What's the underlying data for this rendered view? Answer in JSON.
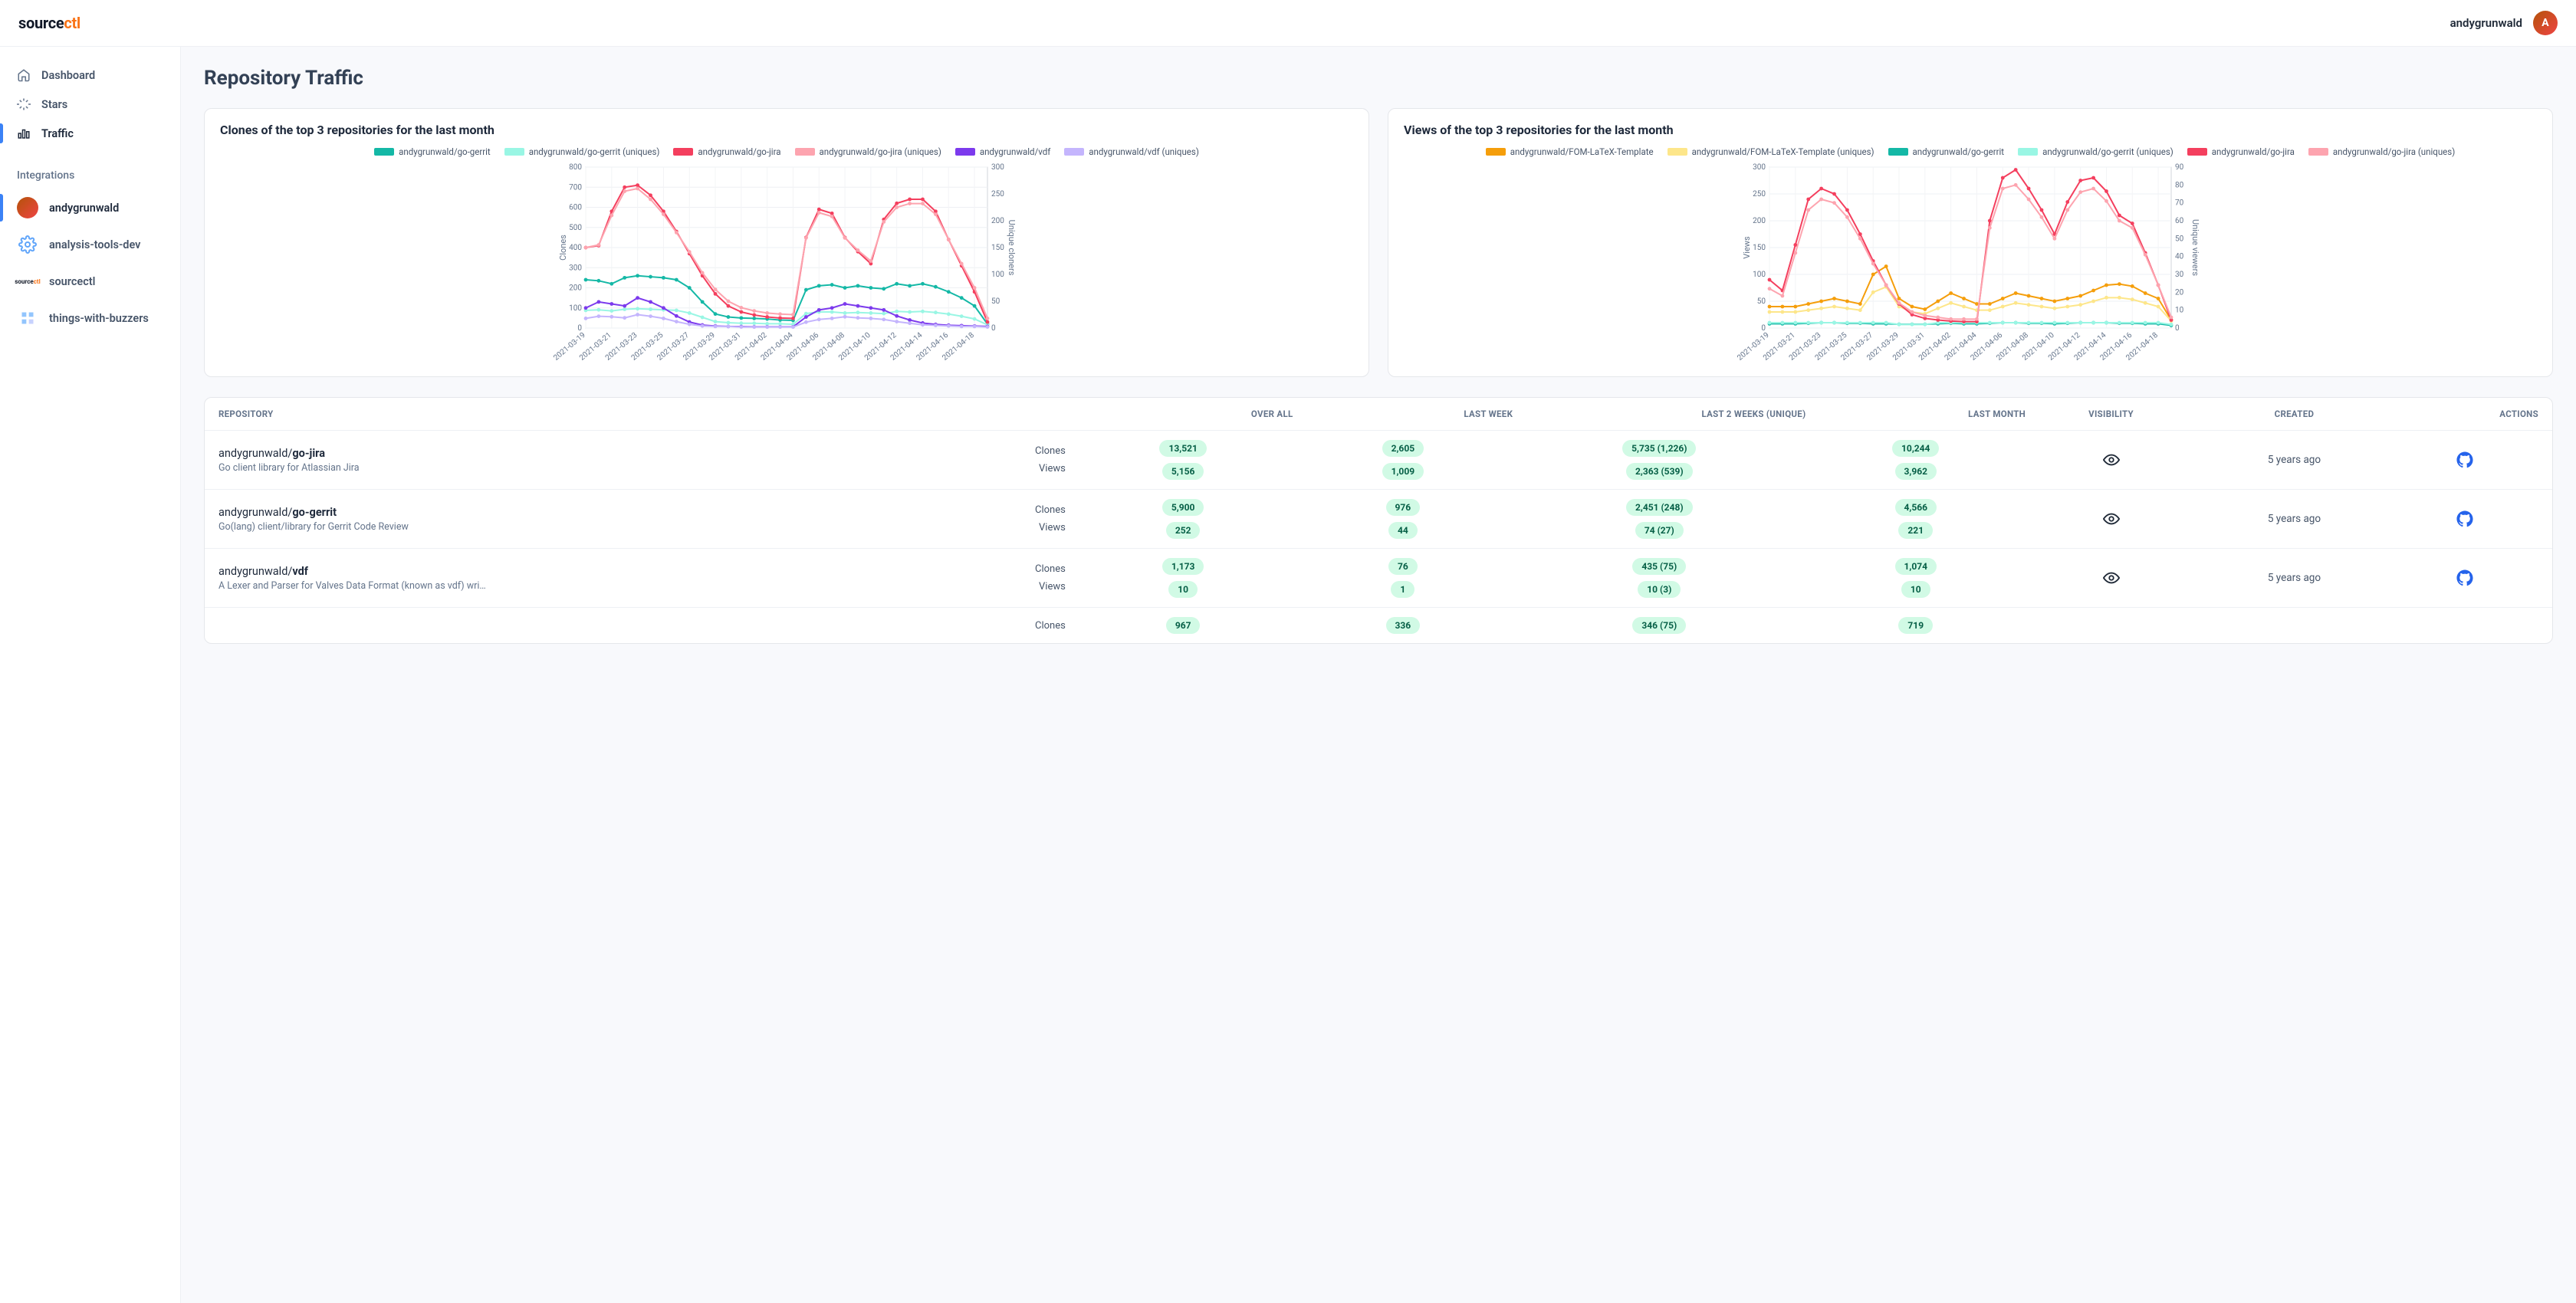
{
  "brand": {
    "part1": "source",
    "part2": "ctl"
  },
  "user": {
    "name": "andygrunwald"
  },
  "sidebar": {
    "nav": [
      {
        "label": "Dashboard",
        "icon": "home"
      },
      {
        "label": "Stars",
        "icon": "sparkle"
      },
      {
        "label": "Traffic",
        "icon": "bars",
        "active": true
      }
    ],
    "integrations_label": "Integrations",
    "integrations": [
      {
        "label": "andygrunwald",
        "icon": "avatar",
        "active": true
      },
      {
        "label": "analysis-tools-dev",
        "icon": "gear"
      },
      {
        "label": "sourcectl",
        "icon": "srcctl"
      },
      {
        "label": "things-with-buzzers",
        "icon": "buzz"
      }
    ]
  },
  "page": {
    "title": "Repository Traffic"
  },
  "charts": {
    "clones": {
      "title": "Clones of the top 3 repositories for the last month",
      "y_left_label": "Clones",
      "y_right_label": "Unique cloners",
      "legend": [
        {
          "label": "andygrunwald/go-gerrit",
          "color": "#14b8a6"
        },
        {
          "label": "andygrunwald/go-gerrit (uniques)",
          "color": "#99f6e4"
        },
        {
          "label": "andygrunwald/go-jira",
          "color": "#f43f5e"
        },
        {
          "label": "andygrunwald/go-jira (uniques)",
          "color": "#fda4af"
        },
        {
          "label": "andygrunwald/vdf",
          "color": "#7c3aed"
        },
        {
          "label": "andygrunwald/vdf (uniques)",
          "color": "#c4b5fd"
        }
      ]
    },
    "views": {
      "title": "Views of the top 3 repositories for the last month",
      "y_left_label": "Views",
      "y_right_label": "Unique viewers",
      "legend": [
        {
          "label": "andygrunwald/FOM-LaTeX-Template",
          "color": "#f59e0b"
        },
        {
          "label": "andygrunwald/FOM-LaTeX-Template (uniques)",
          "color": "#fde68a"
        },
        {
          "label": "andygrunwald/go-gerrit",
          "color": "#14b8a6"
        },
        {
          "label": "andygrunwald/go-gerrit (uniques)",
          "color": "#99f6e4"
        },
        {
          "label": "andygrunwald/go-jira",
          "color": "#f43f5e"
        },
        {
          "label": "andygrunwald/go-jira (uniques)",
          "color": "#fda4af"
        }
      ]
    }
  },
  "chart_data": [
    {
      "type": "line",
      "title": "Clones of the top 3 repositories for the last month",
      "x": [
        "2021-03-19",
        "2021-03-20",
        "2021-03-21",
        "2021-03-22",
        "2021-03-23",
        "2021-03-24",
        "2021-03-25",
        "2021-03-26",
        "2021-03-27",
        "2021-03-28",
        "2021-03-29",
        "2021-03-30",
        "2021-03-31",
        "2021-04-01",
        "2021-04-02",
        "2021-04-03",
        "2021-04-04",
        "2021-04-05",
        "2021-04-06",
        "2021-04-07",
        "2021-04-08",
        "2021-04-09",
        "2021-04-10",
        "2021-04-11",
        "2021-04-12",
        "2021-04-13",
        "2021-04-14",
        "2021-04-15",
        "2021-04-16",
        "2021-04-17",
        "2021-04-18",
        "2021-04-19"
      ],
      "y_left": {
        "label": "Clones",
        "range": [
          0,
          800
        ],
        "ticks": [
          0,
          100,
          200,
          300,
          400,
          500,
          600,
          700,
          800
        ]
      },
      "y_right": {
        "label": "Unique cloners",
        "range": [
          0,
          300
        ],
        "ticks": [
          0,
          50,
          100,
          150,
          200,
          250,
          300
        ]
      },
      "series": [
        {
          "name": "andygrunwald/go-gerrit",
          "axis": "left",
          "color": "#14b8a6",
          "values": [
            240,
            235,
            220,
            250,
            260,
            255,
            250,
            240,
            200,
            130,
            70,
            55,
            50,
            48,
            45,
            40,
            38,
            190,
            210,
            215,
            200,
            210,
            200,
            195,
            220,
            210,
            220,
            205,
            180,
            150,
            110,
            20
          ]
        },
        {
          "name": "andygrunwald/go-gerrit (uniques)",
          "axis": "right",
          "color": "#99f6e4",
          "values": [
            33,
            34,
            32,
            35,
            36,
            35,
            34,
            33,
            28,
            20,
            12,
            10,
            9,
            9,
            8,
            8,
            7,
            27,
            30,
            30,
            28,
            29,
            28,
            27,
            31,
            30,
            31,
            29,
            26,
            22,
            17,
            6
          ]
        },
        {
          "name": "andygrunwald/go-jira",
          "axis": "left",
          "color": "#f43f5e",
          "values": [
            400,
            410,
            580,
            700,
            710,
            660,
            580,
            480,
            370,
            260,
            170,
            110,
            80,
            65,
            55,
            50,
            48,
            450,
            590,
            570,
            450,
            380,
            320,
            540,
            620,
            640,
            640,
            580,
            440,
            310,
            180,
            30
          ]
        },
        {
          "name": "andygrunwald/go-jira (uniques)",
          "axis": "right",
          "color": "#fda4af",
          "values": [
            150,
            155,
            210,
            255,
            260,
            240,
            212,
            178,
            142,
            103,
            72,
            50,
            38,
            32,
            28,
            26,
            25,
            168,
            215,
            208,
            168,
            145,
            125,
            198,
            225,
            232,
            232,
            212,
            165,
            120,
            75,
            18
          ]
        },
        {
          "name": "andygrunwald/vdf",
          "axis": "left",
          "color": "#7c3aed",
          "values": [
            100,
            130,
            120,
            110,
            150,
            130,
            100,
            60,
            30,
            15,
            10,
            8,
            7,
            6,
            6,
            6,
            6,
            55,
            90,
            100,
            120,
            110,
            100,
            90,
            60,
            40,
            25,
            18,
            14,
            12,
            10,
            8
          ]
        },
        {
          "name": "andygrunwald/vdf (uniques)",
          "axis": "right",
          "color": "#c4b5fd",
          "values": [
            18,
            22,
            21,
            19,
            25,
            22,
            18,
            12,
            7,
            4,
            3,
            3,
            2,
            2,
            2,
            2,
            2,
            11,
            16,
            18,
            21,
            19,
            18,
            16,
            12,
            9,
            6,
            5,
            4,
            3,
            3,
            2
          ]
        }
      ]
    },
    {
      "type": "line",
      "title": "Views of the top 3 repositories for the last month",
      "x": [
        "2021-03-19",
        "2021-03-20",
        "2021-03-21",
        "2021-03-22",
        "2021-03-23",
        "2021-03-24",
        "2021-03-25",
        "2021-03-26",
        "2021-03-27",
        "2021-03-28",
        "2021-03-29",
        "2021-03-30",
        "2021-03-31",
        "2021-04-01",
        "2021-04-02",
        "2021-04-03",
        "2021-04-04",
        "2021-04-05",
        "2021-04-06",
        "2021-04-07",
        "2021-04-08",
        "2021-04-09",
        "2021-04-10",
        "2021-04-11",
        "2021-04-12",
        "2021-04-13",
        "2021-04-14",
        "2021-04-15",
        "2021-04-16",
        "2021-04-17",
        "2021-04-18",
        "2021-04-19"
      ],
      "y_left": {
        "label": "Views",
        "range": [
          0,
          300
        ],
        "ticks": [
          0,
          50,
          100,
          150,
          200,
          250,
          300
        ]
      },
      "y_right": {
        "label": "Unique viewers",
        "range": [
          0,
          90
        ],
        "ticks": [
          0,
          10,
          20,
          30,
          40,
          50,
          60,
          70,
          80,
          90
        ]
      },
      "series": [
        {
          "name": "andygrunwald/FOM-LaTeX-Template",
          "axis": "left",
          "color": "#f59e0b",
          "values": [
            40,
            40,
            40,
            45,
            50,
            55,
            50,
            45,
            100,
            115,
            55,
            40,
            35,
            50,
            65,
            55,
            45,
            45,
            55,
            65,
            60,
            55,
            50,
            55,
            60,
            70,
            80,
            82,
            78,
            65,
            55,
            15
          ]
        },
        {
          "name": "andygrunwald/FOM-LaTeX-Template (uniques)",
          "axis": "right",
          "color": "#fde68a",
          "values": [
            9,
            9,
            9,
            10,
            11,
            12,
            11,
            10,
            20,
            23,
            12,
            9,
            8,
            11,
            14,
            12,
            10,
            10,
            12,
            14,
            13,
            12,
            11,
            12,
            13,
            15,
            17,
            17,
            16,
            14,
            12,
            4
          ]
        },
        {
          "name": "andygrunwald/go-gerrit",
          "axis": "left",
          "color": "#14b8a6",
          "values": [
            8,
            8,
            8,
            9,
            10,
            10,
            9,
            9,
            8,
            8,
            7,
            7,
            7,
            8,
            9,
            8,
            8,
            9,
            10,
            10,
            9,
            9,
            8,
            9,
            10,
            10,
            10,
            9,
            9,
            8,
            8,
            5
          ]
        },
        {
          "name": "andygrunwald/go-gerrit (uniques)",
          "axis": "right",
          "color": "#99f6e4",
          "values": [
            3,
            3,
            3,
            3,
            3,
            3,
            3,
            3,
            3,
            3,
            2,
            2,
            2,
            3,
            3,
            3,
            3,
            3,
            3,
            3,
            3,
            3,
            3,
            3,
            3,
            3,
            3,
            3,
            3,
            3,
            3,
            2
          ]
        },
        {
          "name": "andygrunwald/go-jira",
          "axis": "left",
          "color": "#f43f5e",
          "values": [
            90,
            70,
            155,
            240,
            260,
            250,
            220,
            175,
            125,
            80,
            45,
            25,
            18,
            15,
            13,
            12,
            12,
            200,
            280,
            295,
            260,
            220,
            175,
            235,
            275,
            280,
            255,
            210,
            195,
            140,
            80,
            15
          ]
        },
        {
          "name": "andygrunwald/go-jira (uniques)",
          "axis": "right",
          "color": "#fda4af",
          "values": [
            22,
            18,
            42,
            66,
            72,
            70,
            62,
            50,
            36,
            24,
            14,
            9,
            7,
            6,
            5,
            5,
            5,
            56,
            78,
            80,
            72,
            62,
            50,
            66,
            76,
            78,
            71,
            60,
            56,
            41,
            24,
            6
          ]
        }
      ]
    }
  ],
  "table": {
    "headers": {
      "repository": "REPOSITORY",
      "overall": "OVER ALL",
      "last_week": "LAST WEEK",
      "last_2_weeks": "LAST 2 WEEKS (UNIQUE)",
      "last_month": "LAST MONTH",
      "visibility": "VISIBILITY",
      "created": "CREATED",
      "actions": "ACTIONS"
    },
    "metric_labels": {
      "clones": "Clones",
      "views": "Views"
    },
    "rows": [
      {
        "owner": "andygrunwald/",
        "name": "go-jira",
        "desc": "Go client library for Atlassian Jira",
        "clones": {
          "overall": "13,521",
          "week": "2,605",
          "two_weeks": "5,735 (1,226)",
          "month": "10,244"
        },
        "views": {
          "overall": "5,156",
          "week": "1,009",
          "two_weeks": "2,363 (539)",
          "month": "3,962"
        },
        "created": "5 years ago"
      },
      {
        "owner": "andygrunwald/",
        "name": "go-gerrit",
        "desc": "Go(lang) client/library for Gerrit Code Review",
        "clones": {
          "overall": "5,900",
          "week": "976",
          "two_weeks": "2,451 (248)",
          "month": "4,566"
        },
        "views": {
          "overall": "252",
          "week": "44",
          "two_weeks": "74 (27)",
          "month": "221"
        },
        "created": "5 years ago"
      },
      {
        "owner": "andygrunwald/",
        "name": "vdf",
        "desc": "A Lexer and Parser for Valves Data Format (known as vdf) wri…",
        "clones": {
          "overall": "1,173",
          "week": "76",
          "two_weeks": "435 (75)",
          "month": "1,074"
        },
        "views": {
          "overall": "10",
          "week": "1",
          "two_weeks": "10 (3)",
          "month": "10"
        },
        "created": "5 years ago"
      },
      {
        "owner": "",
        "name": "",
        "desc": "",
        "clones": {
          "overall": "967",
          "week": "336",
          "two_weeks": "346 (75)",
          "month": "719"
        },
        "views": {
          "overall": "",
          "week": "",
          "two_weeks": "",
          "month": ""
        },
        "created": ""
      }
    ]
  }
}
